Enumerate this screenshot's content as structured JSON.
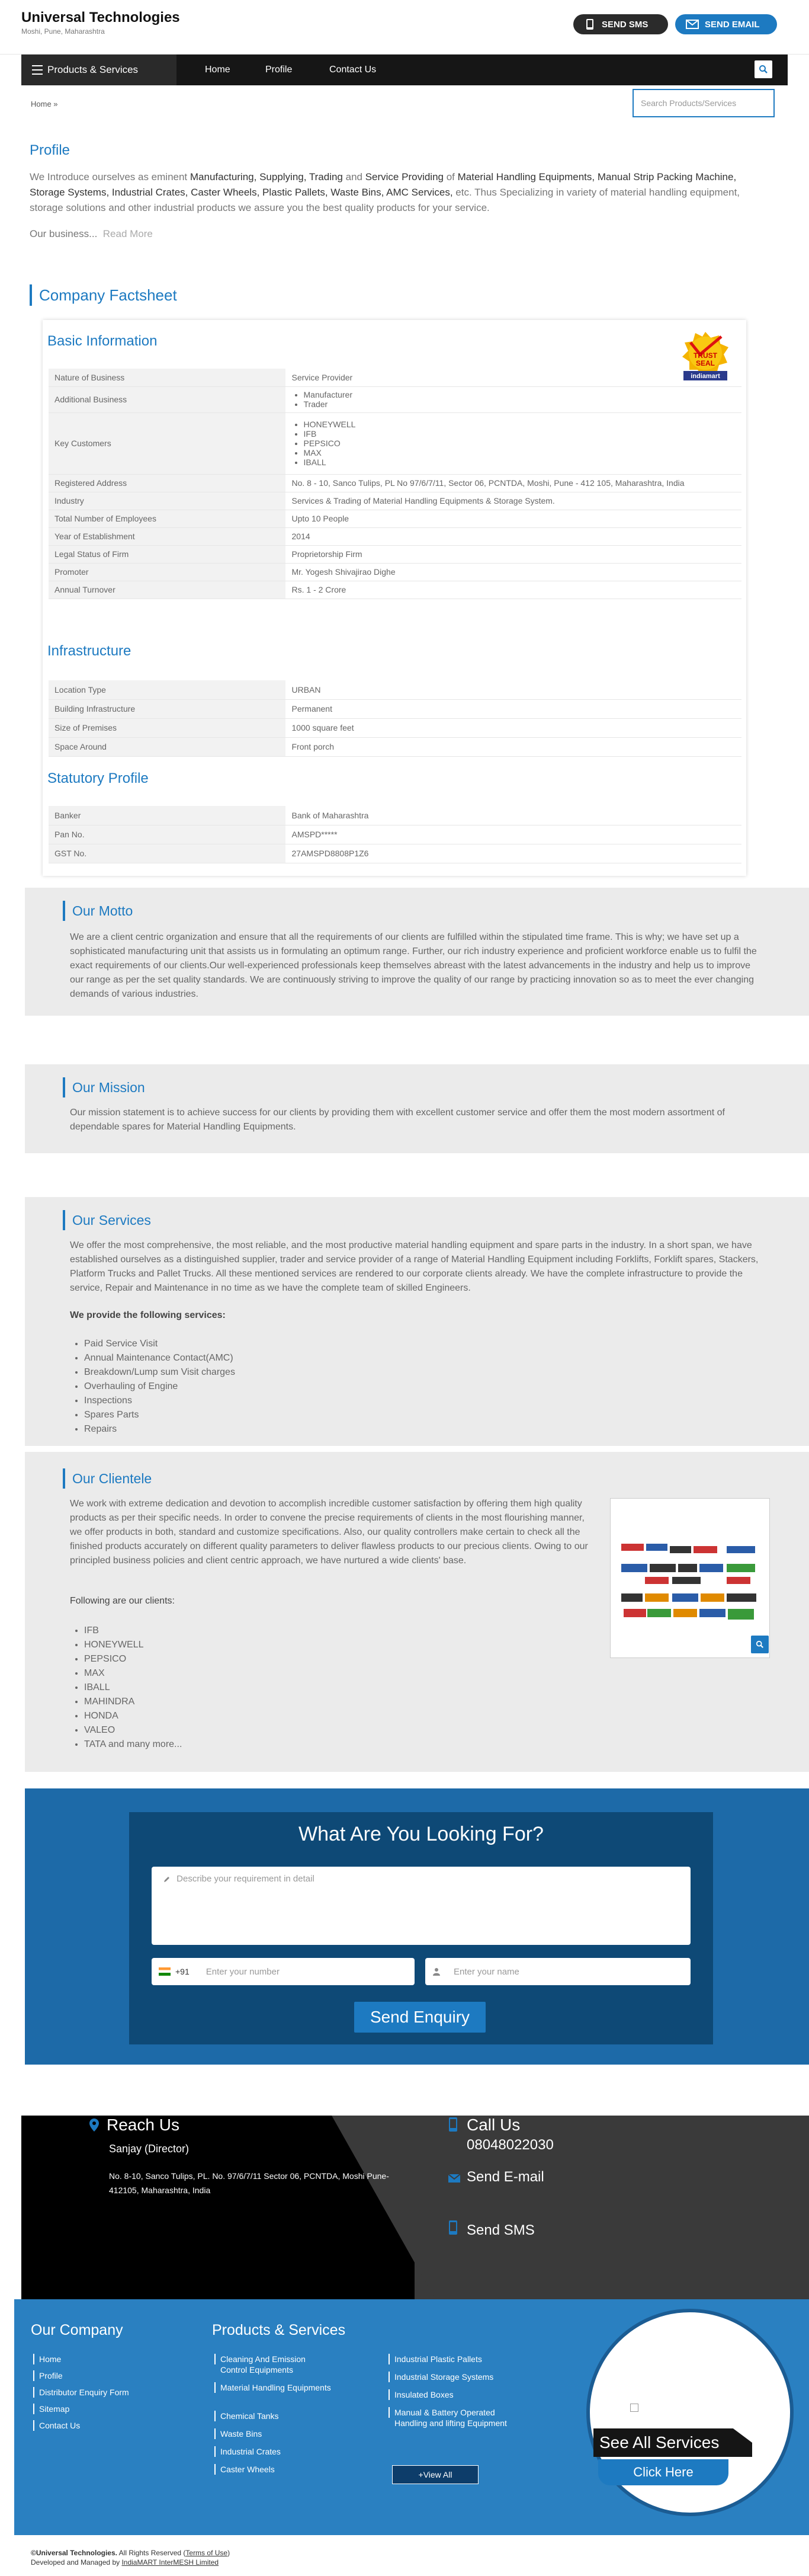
{
  "header": {
    "company_name": "Universal Technologies",
    "location": "Moshi, Pune, Maharashtra",
    "send_sms": "SEND SMS",
    "send_email": "SEND EMAIL"
  },
  "nav": {
    "products": "Products & Services",
    "home": "Home",
    "profile": "Profile",
    "contact": "Contact Us",
    "search_placeholder": "Search Products/Services"
  },
  "breadcrumb": "Home »",
  "profile": {
    "title": "Profile",
    "intro": "We Introduce ourselves as eminent ",
    "roles": "Manufacturing, Supplying, Trading",
    "and": " and ",
    "role2": "Service Providing",
    "of": " of ",
    "products": "Material Handling Equipments, Manual Strip Packing Machine, Storage Systems, Industrial Crates, Caster Wheels, Plastic Pallets, Waste Bins, AMC Services,",
    "rest": " etc. Thus Specializing in variety of material handling equipment, storage solutions and other industrial products we assure you the best quality products for your service.",
    "more_prefix": "Our business...",
    "read_more": "Read More"
  },
  "factsheet": {
    "title": "Company Factsheet",
    "basic_title": "Basic Information",
    "basic": [
      {
        "k": "Nature of Business",
        "v": "Service Provider"
      },
      {
        "k": "Additional Business",
        "list": [
          "Manufacturer",
          "Trader"
        ]
      },
      {
        "k": "Key Customers",
        "list": [
          "HONEYWELL",
          "IFB",
          "PEPSICO",
          "MAX",
          "IBALL"
        ]
      },
      {
        "k": "Registered Address",
        "v": "No. 8 - 10, Sanco Tulips, PL No 97/6/7/11, Sector 06, PCNTDA, Moshi, Pune - 412 105, Maharashtra, India"
      },
      {
        "k": "Industry",
        "v": "Services & Trading of Material Handling Equipments & Storage System."
      },
      {
        "k": "Total Number of Employees",
        "v": "Upto 10 People"
      },
      {
        "k": "Year of Establishment",
        "v": "2014"
      },
      {
        "k": "Legal Status of Firm",
        "v": "Proprietorship Firm"
      },
      {
        "k": "Promoter",
        "v": "Mr. Yogesh Shivajirao Dighe"
      },
      {
        "k": "Annual Turnover",
        "v": "Rs. 1 - 2 Crore"
      }
    ],
    "infra_title": "Infrastructure",
    "infra": [
      {
        "k": "Location Type",
        "v": "URBAN"
      },
      {
        "k": "Building Infrastructure",
        "v": "Permanent"
      },
      {
        "k": "Size of Premises",
        "v": "1000 square feet"
      },
      {
        "k": "Space Around",
        "v": "Front porch"
      }
    ],
    "stat_title": "Statutory Profile",
    "stat": [
      {
        "k": "Banker",
        "v": "Bank of Maharashtra"
      },
      {
        "k": "Pan No.",
        "v": "AMSPD*****"
      },
      {
        "k": "GST No.",
        "v": "27AMSPD8808P1Z6"
      }
    ],
    "trust_seal": {
      "line1": "TRUST",
      "line2": "SEAL",
      "brand": "indiamart"
    }
  },
  "motto": {
    "title": "Our Motto",
    "text": "We are a client centric organization and ensure that all the requirements of our clients are fulfilled within the stipulated time frame. This is why; we have set up a sophisticated manufacturing unit that assists us in formulating an optimum range. Further, our rich industry experience and proficient workforce enable us to fulfil the exact requirements of our clients.Our well-experienced professionals keep themselves abreast with the latest advancements in the industry and help us to improve our range as per the set quality standards. We are continuously striving to improve the quality of our range by practicing innovation so as to meet the ever changing demands of various industries."
  },
  "mission": {
    "title": "Our Mission",
    "text": "Our mission statement is to achieve success for our clients by providing them with excellent customer service and offer them the most modern assortment of dependable spares for Material Handling Equipments."
  },
  "services": {
    "title": "Our Services",
    "text": "We offer the most comprehensive, the most reliable, and the most productive material handling equipment and spare parts in the industry. In a short span, we have established ourselves as a distinguished supplier, trader and service provider of a range of Material Handling Equipment including Forklifts, Forklift spares, Stackers, Platform Trucks and Pallet Trucks.  All these mentioned services are rendered to our corporate clients already. We have the complete infrastructure to provide the service, Repair and Maintenance in no time as we have the complete team of skilled Engineers.",
    "list_heading": "We provide the following services:",
    "items": [
      "Paid Service Visit",
      "Annual Maintenance Contact(AMC)",
      "Breakdown/Lump sum Visit charges",
      "Overhauling of Engine",
      "Inspections",
      "Spares Parts",
      "Repairs"
    ]
  },
  "clientele": {
    "title": "Our Clientele",
    "text": "We work with extreme dedication and devotion to accomplish incredible customer satisfaction by offering them high quality products as per their specific needs. In order to convene the precise requirements of clients in the most flourishing manner, we offer products in both, standard and customize specifications. Also, our quality controllers make certain to check all the finished products accurately on different quality parameters to deliver flawless products to our precious clients. Owing to our principled business policies and client centric approach, we have nurtured a wide clients' base.",
    "list_heading": "Following are our clients:",
    "items": [
      "IFB",
      "HONEYWELL",
      "PEPSICO",
      "MAX",
      "IBALL",
      "MAHINDRA",
      "HONDA",
      "VALEO",
      "TATA and many more..."
    ]
  },
  "enquiry": {
    "title": "What Are You Looking For?",
    "textarea_placeholder": "Describe your requirement in detail",
    "country_code": "+91",
    "phone_placeholder": "Enter your number",
    "name_placeholder": "Enter your name",
    "submit": "Send Enquiry"
  },
  "contact": {
    "reach_us": "Reach Us",
    "person": "Sanjay (Director)",
    "address": "No. 8-10, Sanco Tulips, PL. No. 97/6/7/11 Sector 06, PCNTDA, Moshi Pune- 412105, Maharashtra, India",
    "call_us": "Call Us",
    "phone": "08048022030",
    "send_email": "Send E-mail",
    "send_sms": "Send SMS"
  },
  "footer": {
    "company_heading": "Our Company",
    "company_links": [
      "Home",
      "Profile",
      "Distributor Enquiry Form",
      "Sitemap",
      "Contact Us"
    ],
    "products_heading": "Products & Services",
    "products_col1": [
      "Cleaning And Emission Control Equipments",
      "Material Handling Equipments",
      "Chemical Tanks",
      "Waste Bins",
      "Industrial Crates",
      "Caster Wheels"
    ],
    "products_col2": [
      "Industrial Plastic Pallets",
      "Industrial Storage Systems",
      "Insulated Boxes",
      "Manual & Battery Operated Handling and lifting Equipment"
    ],
    "view_all": "+View All",
    "see_all": "See All Services",
    "click_here": "Click Here"
  },
  "copyright": {
    "brand": "©Universal Technologies.",
    "rights": " All Rights Reserved (",
    "terms": "Terms of Use",
    "close": ")",
    "developed": "Developed and Managed by ",
    "im": "IndiaMART InterMESH Limited"
  }
}
